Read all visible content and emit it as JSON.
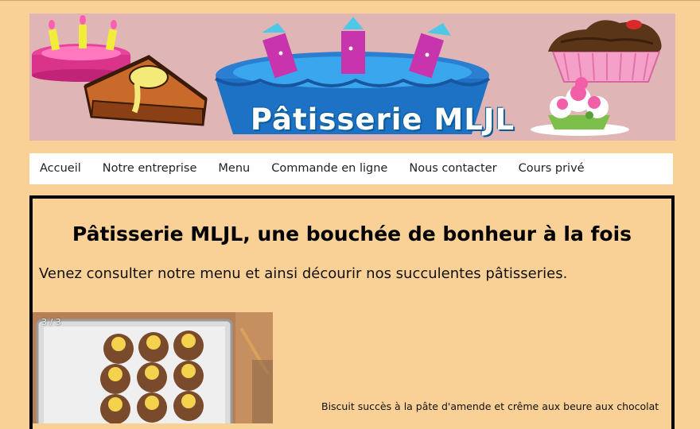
{
  "banner": {
    "title": "Pâtisserie MLJL"
  },
  "nav": {
    "items": [
      {
        "label": "Accueil"
      },
      {
        "label": "Notre entreprise"
      },
      {
        "label": "Menu"
      },
      {
        "label": "Commande en ligne"
      },
      {
        "label": "Nous contacter"
      },
      {
        "label": "Cours privé"
      }
    ]
  },
  "main": {
    "title": "Pâtisserie MLJL, une bouchée de bonheur à la fois",
    "intro": "Venez consulter notre menu et ainsi décourir nos succulentes pâtisseries.",
    "slideshow": {
      "counter": "3 / 3",
      "caption": "Biscuit succès à la pâte d'amende et crême aux beure aux chocolat"
    }
  },
  "colors": {
    "page_background": "#f9d095",
    "banner_background": "#dfb5b6",
    "nav_background": "#ffffff",
    "content_border": "#000000",
    "title_outline": "#0b5d99"
  }
}
